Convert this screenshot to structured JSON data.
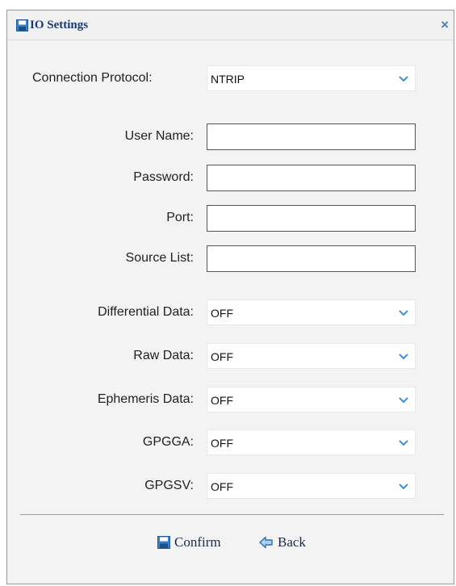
{
  "dialog": {
    "title": "IO Settings",
    "close_glyph": "×"
  },
  "form": {
    "connection_protocol": {
      "label": "Connection Protocol:",
      "value": "NTRIP"
    },
    "user_name": {
      "label": "User Name:",
      "value": ""
    },
    "password": {
      "label": "Password:",
      "value": ""
    },
    "port": {
      "label": "Port:",
      "value": ""
    },
    "source_list": {
      "label": "Source List:",
      "value": ""
    },
    "differential_data": {
      "label": "Differential Data:",
      "value": "OFF"
    },
    "raw_data": {
      "label": "Raw Data:",
      "value": "OFF"
    },
    "ephemeris_data": {
      "label": "Ephemeris Data:",
      "value": "OFF"
    },
    "gpgga": {
      "label": "GPGGA:",
      "value": "OFF"
    },
    "gpgsv": {
      "label": "GPGSV:",
      "value": "OFF"
    }
  },
  "footer": {
    "confirm_label": "Confirm",
    "back_label": "Back"
  },
  "icons": {
    "title": "save-icon",
    "close": "close-icon",
    "dropdown": "chevron-down-icon",
    "confirm": "save-icon",
    "back": "back-arrow-icon"
  },
  "colors": {
    "accent": "#3d7fc4",
    "title_text": "#1b3a73",
    "dialog_bg": "#f3f3f3"
  }
}
